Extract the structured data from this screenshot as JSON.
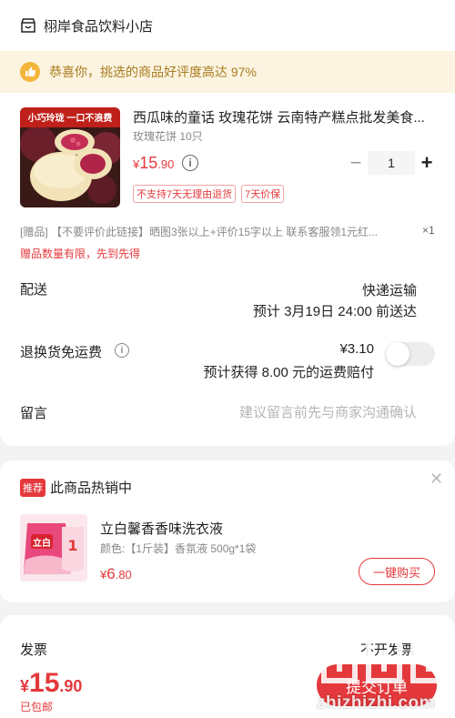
{
  "shop": {
    "name": "栩岸食品饮料小店",
    "icon": "store-icon"
  },
  "praise": {
    "text": "恭喜你，挑选的商品好评度高达 97%"
  },
  "product": {
    "title": "西瓜味的童话 玫瑰花饼 云南特产糕点批发美食...",
    "spec": "玫瑰花饼 10只",
    "price_currency": "¥",
    "price_int": "15",
    "price_dec": ".90",
    "quantity": "1",
    "tags": [
      "不支持7天无理由退货",
      "7天价保"
    ],
    "image_banner": "小巧玲珑 一口不浪费"
  },
  "gift": {
    "line": "[赠品] 【不要评价此链接】晒图3张以上+评价15字以上 联系客服领1元红...",
    "qty": "×1",
    "warning": "赠品数量有限，先到先得"
  },
  "delivery": {
    "label": "配送",
    "method": "快递运输",
    "eta": "预计 3月19日 24:00 前送达"
  },
  "return_shipping": {
    "label": "退换货免运费",
    "price": "¥3.10",
    "note": "预计获得 8.00 元的运费赔付",
    "enabled": false
  },
  "message": {
    "label": "留言",
    "placeholder": "建议留言前先与商家沟通确认"
  },
  "recommend": {
    "badge": "推荐",
    "title": "此商品热销中",
    "name": "立白馨香香味洗衣液",
    "spec": "颜色:【1斤装】香氛液 500g*1袋",
    "price_currency": "¥",
    "price_int": "6",
    "price_dec": ".80",
    "buy_label": "一键购买",
    "brand_mark": "立白"
  },
  "invoice": {
    "label": "发票",
    "value": "不开发票"
  },
  "footer": {
    "total_currency": "¥",
    "total_int": "15",
    "total_dec": ".90",
    "shipping_note": "已包邮",
    "submit_label": "提交订单"
  },
  "watermark": {
    "text": "zhizhizhi.com"
  },
  "colors": {
    "accent": "#e4393c",
    "praise_bg": "#fcf4e0",
    "praise_text": "#a77b1f"
  }
}
